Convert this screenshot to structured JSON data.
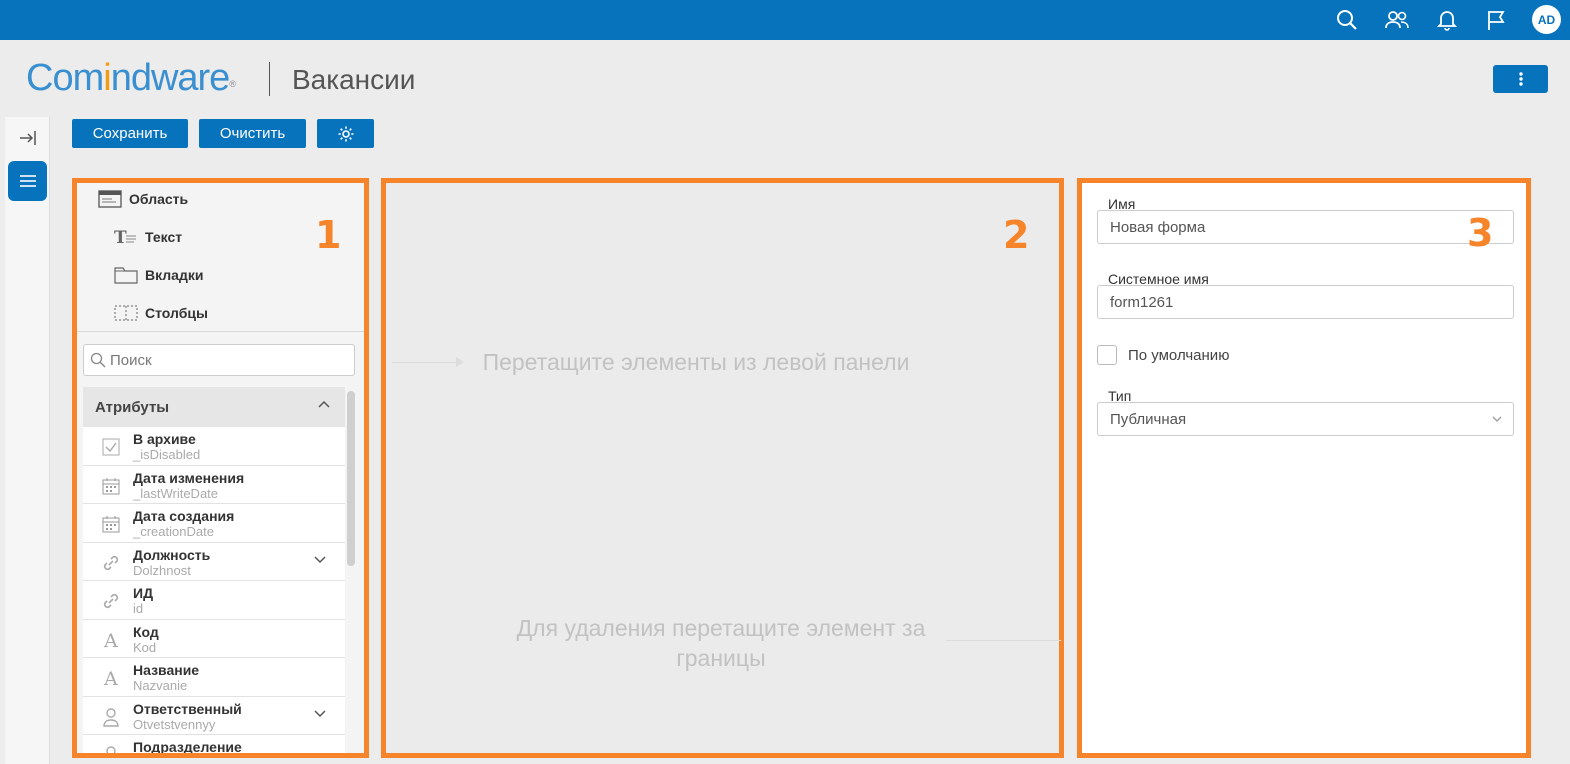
{
  "topbar": {
    "icons": [
      "search-icon",
      "users-icon",
      "bell-icon",
      "flag-icon"
    ],
    "avatar_initials": "AD",
    "color": "#0873bd"
  },
  "header": {
    "logo_part1": "Com",
    "logo_part2": "i",
    "logo_part3": "ndware",
    "logo_reg": "®",
    "title": "Вакансии",
    "more_icon": "vertical-dots-icon"
  },
  "toolbar": {
    "save_label": "Сохранить",
    "clear_label": "Очистить",
    "settings_icon": "gear-icon"
  },
  "annotations": {
    "panel1": "1",
    "panel2": "2",
    "panel3": "3",
    "accent": "#f6842a"
  },
  "left_panel": {
    "layout_items": [
      {
        "label": "Область",
        "icon": "area-icon"
      },
      {
        "label": "Текст",
        "icon": "text-icon"
      },
      {
        "label": "Вкладки",
        "icon": "tabs-icon"
      },
      {
        "label": "Столбцы",
        "icon": "columns-icon"
      }
    ],
    "search_placeholder": "Поиск",
    "attributes_header": "Атрибуты",
    "attributes": [
      {
        "name": "В архиве",
        "system": "_isDisabled",
        "icon": "checkbox-icon",
        "expandable": false
      },
      {
        "name": "Дата изменения",
        "system": "_lastWriteDate",
        "icon": "calendar-icon",
        "expandable": false
      },
      {
        "name": "Дата создания",
        "system": "_creationDate",
        "icon": "calendar-icon",
        "expandable": false
      },
      {
        "name": "Должность",
        "system": "Dolzhnost",
        "icon": "link-icon",
        "expandable": true
      },
      {
        "name": "ИД",
        "system": "id",
        "icon": "link-icon",
        "expandable": false
      },
      {
        "name": "Код",
        "system": "Kod",
        "icon": "text-a-icon",
        "expandable": false
      },
      {
        "name": "Название",
        "system": "Nazvanie",
        "icon": "text-a-icon",
        "expandable": false
      },
      {
        "name": "Ответственный",
        "system": "Otvetstvennyy",
        "icon": "person-icon",
        "expandable": true
      },
      {
        "name": "Подразделение",
        "system": "",
        "icon": "person-icon",
        "expandable": false
      }
    ]
  },
  "middle_panel": {
    "drop_hint": "Перетащите элементы из левой панели",
    "remove_hint": "Для удаления перетащите элемент за границы"
  },
  "right_panel": {
    "name_label": "Имя",
    "name_value": "Новая форма",
    "system_name_label": "Системное имя",
    "system_name_value": "form1261",
    "default_label": "По умолчанию",
    "default_checked": false,
    "type_label": "Тип",
    "type_value": "Публичная"
  }
}
